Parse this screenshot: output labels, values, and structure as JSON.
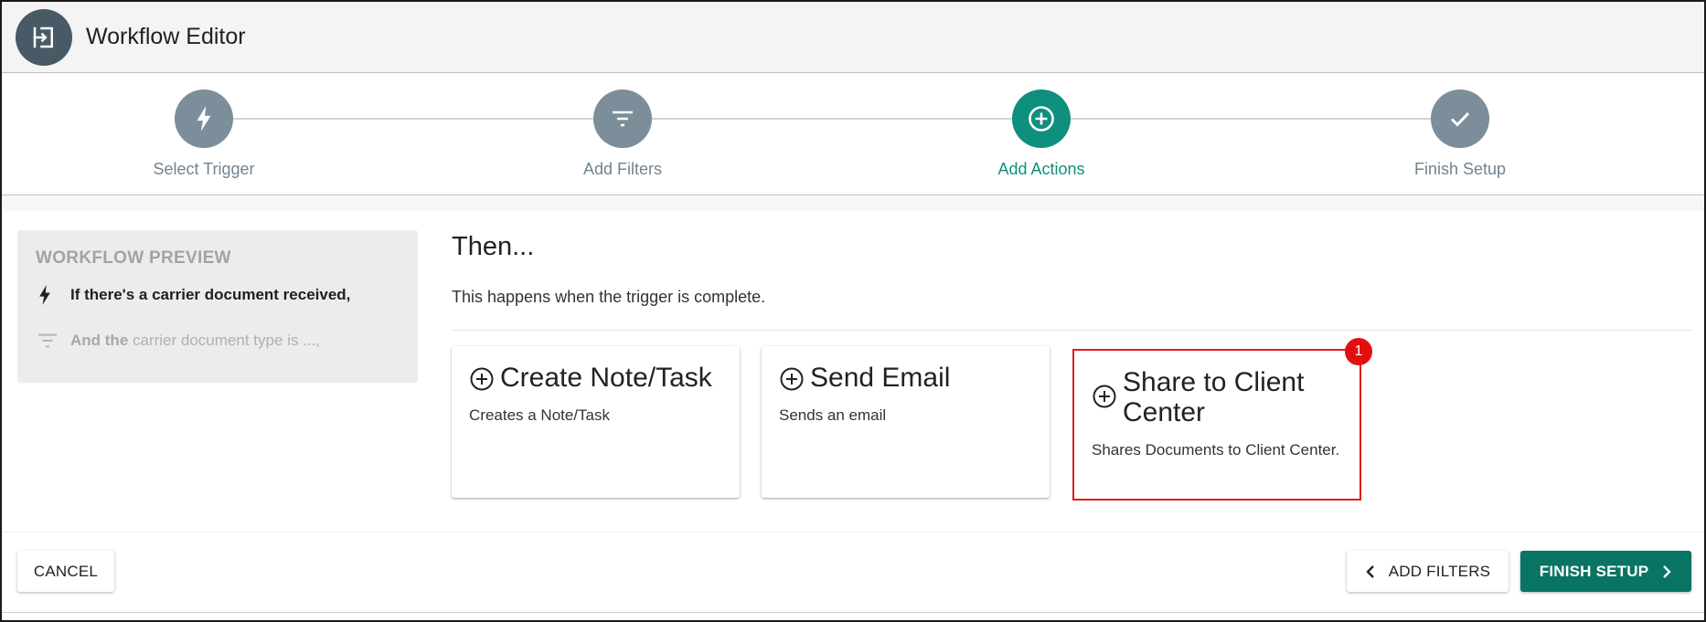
{
  "header": {
    "title": "Workflow Editor",
    "icon": "exit-to-app-icon"
  },
  "stepper": {
    "steps": [
      {
        "label": "Select Trigger",
        "icon": "bolt-icon",
        "active": false
      },
      {
        "label": "Add Filters",
        "icon": "filter-icon",
        "active": false
      },
      {
        "label": "Add Actions",
        "icon": "add-circle-icon",
        "active": true
      },
      {
        "label": "Finish Setup",
        "icon": "check-icon",
        "active": false
      }
    ]
  },
  "preview": {
    "title": "WORKFLOW PREVIEW",
    "trigger_text": "If there's a carrier document received,",
    "filter_prefix": "And the",
    "filter_text": " carrier document type is ...,"
  },
  "main": {
    "title": "Then...",
    "subtitle": "This happens when the trigger is complete.",
    "cards": [
      {
        "title": "Create Note/Task",
        "description": "Creates a Note/Task"
      },
      {
        "title": "Send Email",
        "description": "Sends an email"
      },
      {
        "title": "Share to Client Center",
        "description": "Shares Documents to Client Center.",
        "badge": "1"
      }
    ]
  },
  "footer": {
    "cancel_label": "CANCEL",
    "back_label": "ADD FILTERS",
    "finish_label": "FINISH SETUP"
  },
  "colors": {
    "accent": "#0f8f7e",
    "step_inactive": "#7b8e99",
    "finish_button": "#0a7464",
    "highlight": "#e01b1b"
  }
}
